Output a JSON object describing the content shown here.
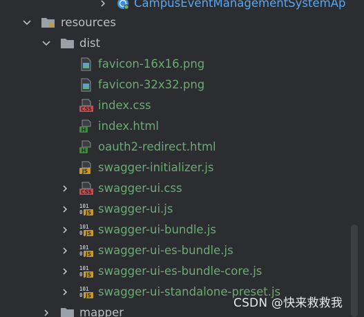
{
  "tree": {
    "items": [
      {
        "label": "CampusEventManagementSystemAp",
        "kind": "class",
        "icon": "spring-app-icon",
        "arrow": "right"
      },
      {
        "label": "resources",
        "kind": "folder",
        "icon": "resources-folder-icon",
        "arrow": "down"
      },
      {
        "label": "dist",
        "kind": "folder",
        "icon": "folder-icon",
        "arrow": "down"
      },
      {
        "label": "favicon-16x16.png",
        "kind": "file",
        "icon": "image-file-icon",
        "arrow": ""
      },
      {
        "label": "favicon-32x32.png",
        "kind": "file",
        "icon": "image-file-icon",
        "arrow": ""
      },
      {
        "label": "index.css",
        "kind": "file",
        "icon": "css-file-icon",
        "icon_text": "CSS",
        "arrow": ""
      },
      {
        "label": "index.html",
        "kind": "file",
        "icon": "html-file-icon",
        "icon_text": "H",
        "arrow": ""
      },
      {
        "label": "oauth2-redirect.html",
        "kind": "file",
        "icon": "html-file-icon",
        "icon_text": "H",
        "arrow": ""
      },
      {
        "label": "swagger-initializer.js",
        "kind": "file",
        "icon": "js-file-icon",
        "icon_text": "JS",
        "arrow": ""
      },
      {
        "label": "swagger-ui.css",
        "kind": "file",
        "icon": "css-file-icon",
        "icon_text": "CSS",
        "arrow": "right"
      },
      {
        "label": "swagger-ui.js",
        "kind": "file",
        "icon": "binary-js-file-icon",
        "icon_text": "JS",
        "arrow": "right"
      },
      {
        "label": "swagger-ui-bundle.js",
        "kind": "file",
        "icon": "binary-js-file-icon",
        "icon_text": "JS",
        "arrow": "right"
      },
      {
        "label": "swagger-ui-es-bundle.js",
        "kind": "file",
        "icon": "binary-js-file-icon",
        "icon_text": "JS",
        "arrow": "right"
      },
      {
        "label": "swagger-ui-es-bundle-core.js",
        "kind": "file",
        "icon": "binary-js-file-icon",
        "icon_text": "JS",
        "arrow": "right"
      },
      {
        "label": "swagger-ui-standalone-preset.js",
        "kind": "file",
        "icon": "binary-js-file-icon",
        "icon_text": "JS",
        "arrow": "right"
      },
      {
        "label": "mapper",
        "kind": "folder",
        "icon": "folder-icon",
        "arrow": "right"
      }
    ]
  },
  "watermark": {
    "text": "CSDN @快来救救我"
  },
  "colors": {
    "background": "#2b2d30",
    "folder_text": "#bcbec4",
    "file_text": "#6aab73",
    "class_text": "#56a8f5",
    "css_badge": "#c94f4f",
    "html_badge": "#3a8d3a",
    "js_badge": "#c79a2c",
    "folder_icon": "#9aa0a6"
  }
}
